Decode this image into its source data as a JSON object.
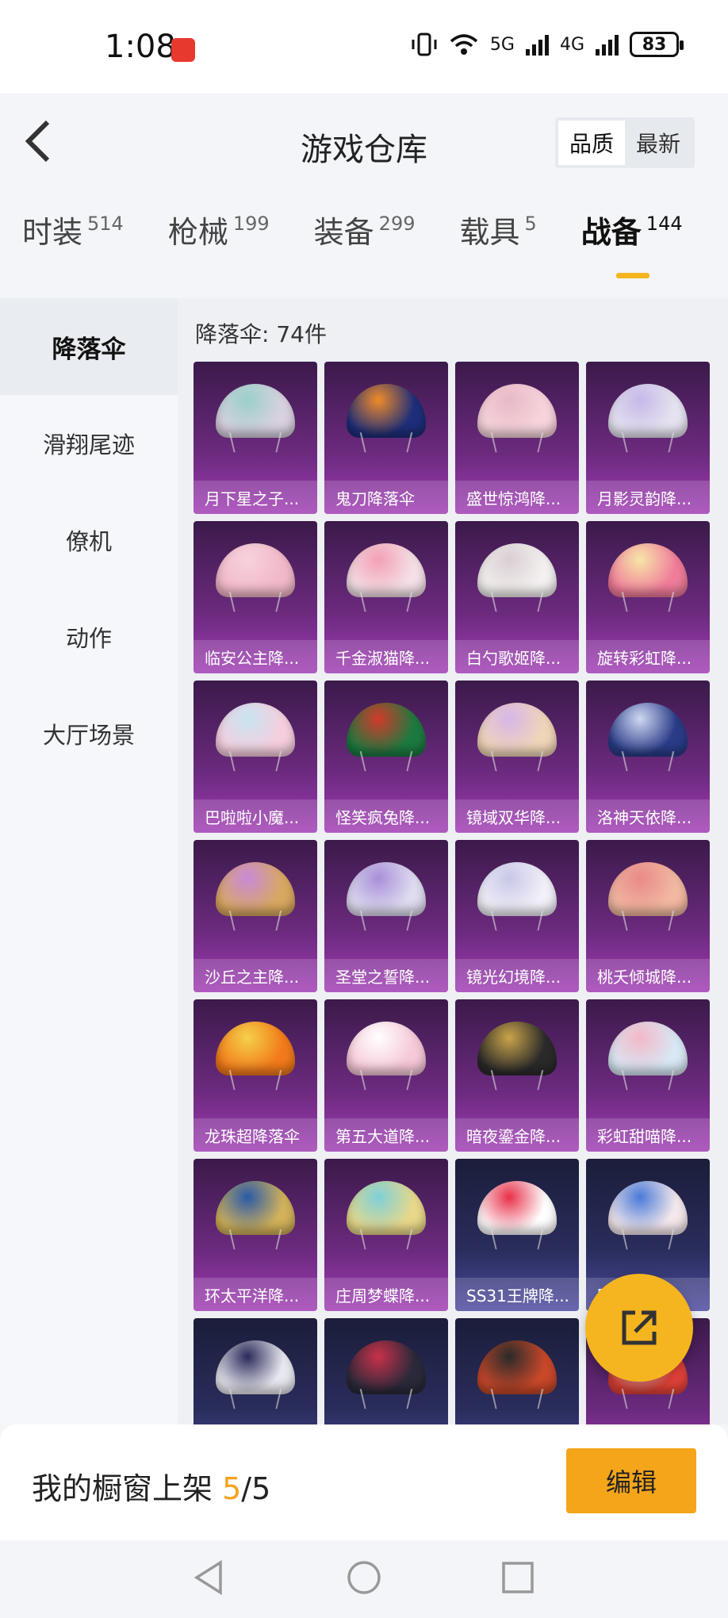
{
  "status": {
    "time": "1:08",
    "battery": "83",
    "net1": "5G",
    "net2": "4G"
  },
  "header": {
    "title": "游戏仓库",
    "sort_options": [
      "品质",
      "最新"
    ]
  },
  "tabs": [
    {
      "label": "时装",
      "count": "514"
    },
    {
      "label": "枪械",
      "count": "199"
    },
    {
      "label": "装备",
      "count": "299"
    },
    {
      "label": "载具",
      "count": "5"
    },
    {
      "label": "战备",
      "count": "144"
    }
  ],
  "sidebar": {
    "items": [
      "降落伞",
      "滑翔尾迹",
      "僚机",
      "动作",
      "大厅场景"
    ]
  },
  "content": {
    "count_label": "降落伞: 74件",
    "items": [
      {
        "name": "月下星之子...",
        "color": "#d9d1e0",
        "accent": "#9ad0c9",
        "variant": "purple"
      },
      {
        "name": "鬼刀降落伞",
        "color": "#1e2e7a",
        "accent": "#f08a2a",
        "variant": "purple"
      },
      {
        "name": "盛世惊鸿降...",
        "color": "#f7d4dc",
        "accent": "#e8b9c6",
        "variant": "purple"
      },
      {
        "name": "月影灵韵降...",
        "color": "#e6e3f0",
        "accent": "#c6b8e8",
        "variant": "purple"
      },
      {
        "name": "临安公主降...",
        "color": "#f1b8c8",
        "accent": "#f6d2dc",
        "variant": "purple"
      },
      {
        "name": "千金淑猫降...",
        "color": "#f4e0e6",
        "accent": "#f3a0b4",
        "variant": "purple"
      },
      {
        "name": "白勺歌姬降...",
        "color": "#f4f0f0",
        "accent": "#d9cfd2",
        "variant": "purple"
      },
      {
        "name": "旋转彩虹降...",
        "color": "#f07c9a",
        "accent": "#f7e6a8",
        "variant": "purple"
      },
      {
        "name": "巴啦啦小魔...",
        "color": "#f6cede",
        "accent": "#c9e4f0",
        "variant": "purple"
      },
      {
        "name": "怪笑疯兔降...",
        "color": "#1c7a40",
        "accent": "#d23a2a",
        "variant": "purple"
      },
      {
        "name": "镜域双华降...",
        "color": "#f0d6b8",
        "accent": "#d6b6e8",
        "variant": "purple"
      },
      {
        "name": "洛神天依降...",
        "color": "#2a3c88",
        "accent": "#cfd8f2",
        "variant": "purple"
      },
      {
        "name": "沙丘之主降...",
        "color": "#d9a860",
        "accent": "#c98ad8",
        "variant": "purple"
      },
      {
        "name": "圣堂之誓降...",
        "color": "#e0dcf0",
        "accent": "#a890d8",
        "variant": "purple"
      },
      {
        "name": "镜光幻境降...",
        "color": "#f2f0f8",
        "accent": "#c8c8e8",
        "variant": "purple"
      },
      {
        "name": "桃夭倾城降...",
        "color": "#f2b9a0",
        "accent": "#e88a8a",
        "variant": "purple"
      },
      {
        "name": "龙珠超降落伞",
        "color": "#f27a1a",
        "accent": "#f5d04a",
        "variant": "purple"
      },
      {
        "name": "第五大道降...",
        "color": "#f6c8d8",
        "accent": "#ffffff",
        "variant": "purple"
      },
      {
        "name": "暗夜鎏金降...",
        "color": "#2a2a2a",
        "accent": "#c9a44a",
        "variant": "purple"
      },
      {
        "name": "彩虹甜喵降...",
        "color": "#d8e8f4",
        "accent": "#f3b8c8",
        "variant": "purple"
      },
      {
        "name": "环太平洋降...",
        "color": "#d2b25a",
        "accent": "#2a5aa8",
        "variant": "purple"
      },
      {
        "name": "庄周梦蝶降...",
        "color": "#e8d88a",
        "accent": "#7fd0d8",
        "variant": "purple"
      },
      {
        "name": "SS31王牌降...",
        "color": "#ffffff",
        "accent": "#e8304a",
        "variant": "blue"
      },
      {
        "name": "回...降...",
        "color": "#f4e8ec",
        "accent": "#4a7ad8",
        "variant": "blue"
      },
      {
        "name": "",
        "color": "#e8e8f0",
        "accent": "#2a2a5a",
        "variant": "blue"
      },
      {
        "name": "",
        "color": "#2a2a3a",
        "accent": "#c8304a",
        "variant": "blue"
      },
      {
        "name": "",
        "color": "#c8482a",
        "accent": "#2a2a2a",
        "variant": "blue"
      },
      {
        "name": "",
        "color": "#e8443a",
        "accent": "#ffffff",
        "variant": "purple"
      }
    ]
  },
  "bottom": {
    "showcase_label": "我的橱窗上架",
    "showcase_current": "5",
    "showcase_total": "/5",
    "edit_label": "编辑"
  },
  "colors": {
    "accent": "#f5b51f",
    "card_purple": "#6b2a7e",
    "card_blue": "#2a2d5c"
  },
  "icons": {
    "back": "chevron-left-icon",
    "share": "external-link-icon",
    "nav_back": "triangle-back-icon",
    "nav_home": "circle-home-icon",
    "nav_recent": "square-recent-icon"
  }
}
